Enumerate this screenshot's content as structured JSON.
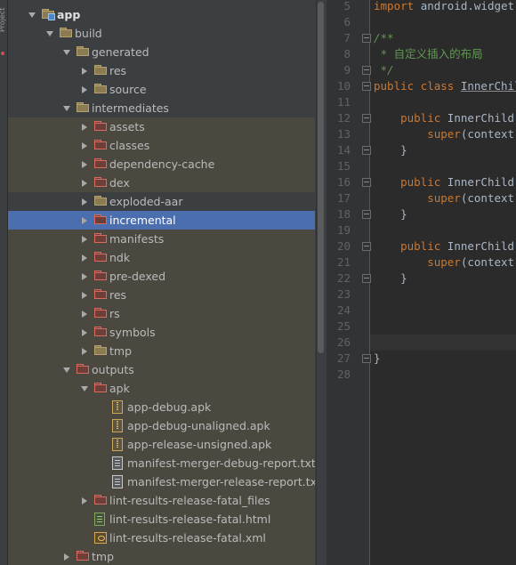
{
  "sidebar": {
    "vertical_tab": "Project"
  },
  "tree": [
    {
      "label": "app",
      "level": 1,
      "arrow": "open",
      "icon": "module",
      "bold": true
    },
    {
      "label": "build",
      "level": 2,
      "arrow": "open",
      "icon": "plain"
    },
    {
      "label": "generated",
      "level": 3,
      "arrow": "open",
      "icon": "plain"
    },
    {
      "label": "res",
      "level": 4,
      "arrow": "closed",
      "icon": "plain"
    },
    {
      "label": "source",
      "level": 4,
      "arrow": "closed",
      "icon": "plain"
    },
    {
      "label": "intermediates",
      "level": 3,
      "arrow": "open",
      "icon": "plain"
    },
    {
      "label": "assets",
      "level": 4,
      "arrow": "closed",
      "icon": "excl",
      "shaded": true
    },
    {
      "label": "classes",
      "level": 4,
      "arrow": "closed",
      "icon": "excl",
      "shaded": true
    },
    {
      "label": "dependency-cache",
      "level": 4,
      "arrow": "closed",
      "icon": "excl",
      "shaded": true
    },
    {
      "label": "dex",
      "level": 4,
      "arrow": "closed",
      "icon": "excl",
      "shaded": true
    },
    {
      "label": "exploded-aar",
      "level": 4,
      "arrow": "closed",
      "icon": "plain"
    },
    {
      "label": "incremental",
      "level": 4,
      "arrow": "closed",
      "icon": "excl",
      "selected": true
    },
    {
      "label": "manifests",
      "level": 4,
      "arrow": "closed",
      "icon": "excl",
      "shaded": true
    },
    {
      "label": "ndk",
      "level": 4,
      "arrow": "closed",
      "icon": "excl",
      "shaded": true
    },
    {
      "label": "pre-dexed",
      "level": 4,
      "arrow": "closed",
      "icon": "excl",
      "shaded": true
    },
    {
      "label": "res",
      "level": 4,
      "arrow": "closed",
      "icon": "excl",
      "shaded": true
    },
    {
      "label": "rs",
      "level": 4,
      "arrow": "closed",
      "icon": "excl",
      "shaded": true
    },
    {
      "label": "symbols",
      "level": 4,
      "arrow": "closed",
      "icon": "excl",
      "shaded": true
    },
    {
      "label": "tmp",
      "level": 4,
      "arrow": "closed",
      "icon": "plain",
      "shaded": true
    },
    {
      "label": "outputs",
      "level": 3,
      "arrow": "open",
      "icon": "excl",
      "shaded": true
    },
    {
      "label": "apk",
      "level": 4,
      "arrow": "open",
      "icon": "excl",
      "shaded": true
    },
    {
      "label": "app-debug.apk",
      "level": 5,
      "arrow": "none",
      "icon": "apk",
      "shaded": true
    },
    {
      "label": "app-debug-unaligned.apk",
      "level": 5,
      "arrow": "none",
      "icon": "apk",
      "shaded": true
    },
    {
      "label": "app-release-unsigned.apk",
      "level": 5,
      "arrow": "none",
      "icon": "apk",
      "shaded": true
    },
    {
      "label": "manifest-merger-debug-report.txt",
      "level": 5,
      "arrow": "none",
      "icon": "txt",
      "shaded": true
    },
    {
      "label": "manifest-merger-release-report.txt",
      "level": 5,
      "arrow": "none",
      "icon": "txt",
      "shaded": true
    },
    {
      "label": "lint-results-release-fatal_files",
      "level": 4,
      "arrow": "closed",
      "icon": "excl",
      "shaded": true
    },
    {
      "label": "lint-results-release-fatal.html",
      "level": 4,
      "arrow": "none",
      "icon": "html",
      "shaded": true
    },
    {
      "label": "lint-results-release-fatal.xml",
      "level": 4,
      "arrow": "none",
      "icon": "xml",
      "shaded": true
    },
    {
      "label": "tmp",
      "level": 3,
      "arrow": "closed",
      "icon": "excl",
      "shaded": true
    }
  ],
  "editor": {
    "lines": [
      {
        "n": "5",
        "code": [
          [
            "kw",
            "import "
          ],
          [
            "p",
            "android.widget"
          ]
        ]
      },
      {
        "n": "6",
        "code": []
      },
      {
        "n": "7",
        "code": [
          [
            "cm",
            "/**"
          ]
        ]
      },
      {
        "n": "8",
        "code": [
          [
            "cm",
            " * "
          ],
          [
            "cmcn",
            "自定义插入的布局"
          ]
        ]
      },
      {
        "n": "9",
        "code": [
          [
            "cm",
            " */"
          ]
        ]
      },
      {
        "n": "10",
        "code": [
          [
            "kw",
            "public class "
          ],
          [
            "cls",
            "InnerChild"
          ]
        ]
      },
      {
        "n": "11",
        "code": []
      },
      {
        "n": "12",
        "code": [
          [
            "kw",
            "    public "
          ],
          [
            "p",
            "InnerChild"
          ]
        ]
      },
      {
        "n": "13",
        "code": [
          [
            "kw",
            "        super"
          ],
          [
            "p",
            "(context"
          ]
        ]
      },
      {
        "n": "14",
        "code": [
          [
            "p",
            "    }"
          ]
        ]
      },
      {
        "n": "15",
        "code": []
      },
      {
        "n": "16",
        "code": [
          [
            "kw",
            "    public "
          ],
          [
            "p",
            "InnerChild"
          ]
        ]
      },
      {
        "n": "17",
        "code": [
          [
            "kw",
            "        super"
          ],
          [
            "p",
            "(context"
          ]
        ]
      },
      {
        "n": "18",
        "code": [
          [
            "p",
            "    }"
          ]
        ]
      },
      {
        "n": "19",
        "code": []
      },
      {
        "n": "20",
        "code": [
          [
            "kw",
            "    public "
          ],
          [
            "p",
            "InnerChild"
          ]
        ]
      },
      {
        "n": "21",
        "code": [
          [
            "kw",
            "        super"
          ],
          [
            "p",
            "(context"
          ]
        ]
      },
      {
        "n": "22",
        "code": [
          [
            "p",
            "    }"
          ]
        ]
      },
      {
        "n": "23",
        "code": []
      },
      {
        "n": "24",
        "code": []
      },
      {
        "n": "25",
        "code": []
      },
      {
        "n": "26",
        "code": []
      },
      {
        "n": "27",
        "code": [
          [
            "p",
            "}"
          ]
        ]
      },
      {
        "n": "28",
        "code": []
      }
    ]
  }
}
